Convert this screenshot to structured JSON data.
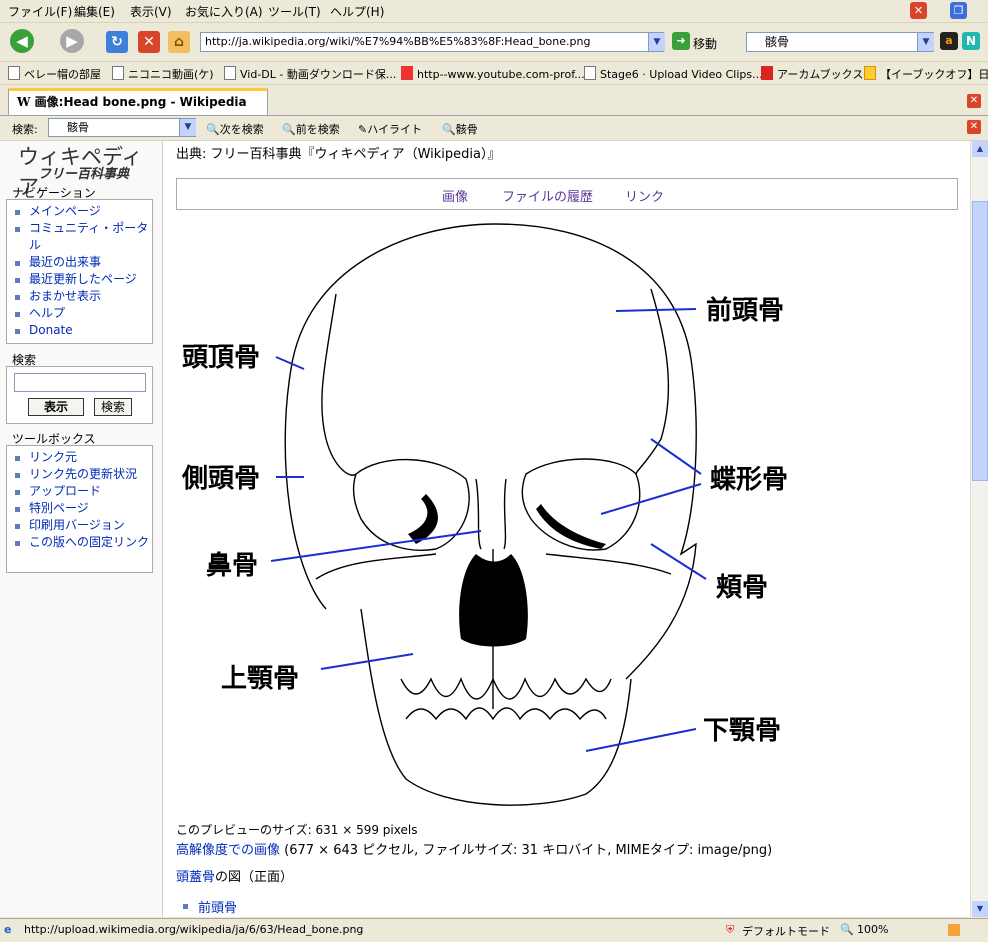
{
  "menu": [
    "ファイル(F)",
    "編集(E)",
    "表示(V)",
    "お気に入り(A)",
    "ツール(T)",
    "ヘルプ(H)"
  ],
  "address": {
    "url": "http://ja.wikipedia.org/wiki/%E7%94%BB%E5%83%8F:Head_bone.png",
    "go_label": "移動"
  },
  "search": {
    "value": "骸骨"
  },
  "bookmarks": [
    "ベレー帽の部屋",
    "ニコニコ動画(ケ)",
    "Vid-DL - 動画ダウンロード保...",
    "http--www.youtube.com-prof...",
    "Stage6 · Upload Video Clips...",
    "アーカムブックス",
    "【イーブックオフ】日:"
  ],
  "tab": {
    "title": "画像:Head bone.png - Wikipedia"
  },
  "findbar": {
    "label": "検索:",
    "value": "骸骨",
    "next": "次を検索",
    "prev": "前を検索",
    "highlight": "ハイライト",
    "term": "骸骨"
  },
  "sidebar": {
    "logo_main": "ウィキペディア",
    "logo_sub": "フリー百科事典",
    "nav_title": "ナビゲーション",
    "nav_items": [
      "メインページ",
      "コミュニティ・ポータル",
      "最近の出来事",
      "最近更新したページ",
      "おまかせ表示",
      "ヘルプ",
      "Donate"
    ],
    "search_title": "検索",
    "search_go": "表示",
    "search_btn": "検索",
    "tools_title": "ツールボックス",
    "tool_items": [
      "リンク元",
      "リンク先の更新状況",
      "アップロード",
      "特別ページ",
      "印刷用バージョン",
      "この版への固定リンク"
    ]
  },
  "content": {
    "source": "出典: フリー百科事典『ウィキペディア（Wikipedia）』",
    "tabs": [
      "画像",
      "ファイルの履歴",
      "リンク"
    ],
    "labels": {
      "frontal": "前頭骨",
      "parietal": "頭頂骨",
      "sphenoid": "蝶形骨",
      "temporal": "側頭骨",
      "nasal": "鼻骨",
      "zygomatic": "頬骨",
      "maxilla": "上顎骨",
      "mandible": "下顎骨"
    },
    "preview_size": "このプレビューのサイズ: 631 × 599 pixels",
    "hires_link": "高解像度での画像",
    "hires_info": " (677 × 643 ピクセル, ファイルサイズ: 31 キロバイト, MIMEタイプ: image/png)",
    "desc_link": "頭蓋骨",
    "desc_text": "の図（正面）",
    "list_first": "前頭骨"
  },
  "status": {
    "url": "http://upload.wikimedia.org/wikipedia/ja/6/63/Head_bone.png",
    "mode": "デフォルトモード",
    "zoom": "100%"
  }
}
